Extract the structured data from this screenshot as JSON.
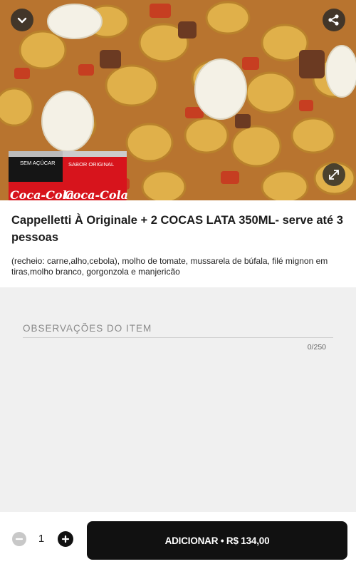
{
  "product": {
    "title": "Cappelletti À Originale + 2 COCAS LATA 350ML- serve até 3 pessoas",
    "description": "(recheio: carne,alho,cebola), molho de tomate, mussarela de búfala, filé mignon em tiras,molho branco, gorgonzola e manjericão"
  },
  "image": {
    "can_left_label": "SEM AÇÚCAR",
    "can_right_label": "SABOR ORIGINAL",
    "can_brand": "Coca-Cola"
  },
  "icons": {
    "back": "chevron-down-icon",
    "share": "share-icon",
    "expand": "expand-icon",
    "minus": "minus-icon",
    "plus": "plus-icon"
  },
  "notes": {
    "placeholder": "OBSERVAÇÕES DO ITEM",
    "counter": "0/250"
  },
  "footer": {
    "quantity": "1",
    "add_label": "ADICIONAR • R$ 134,00"
  },
  "colors": {
    "primary_button": "#111111",
    "coke_red": "#d7141c"
  }
}
